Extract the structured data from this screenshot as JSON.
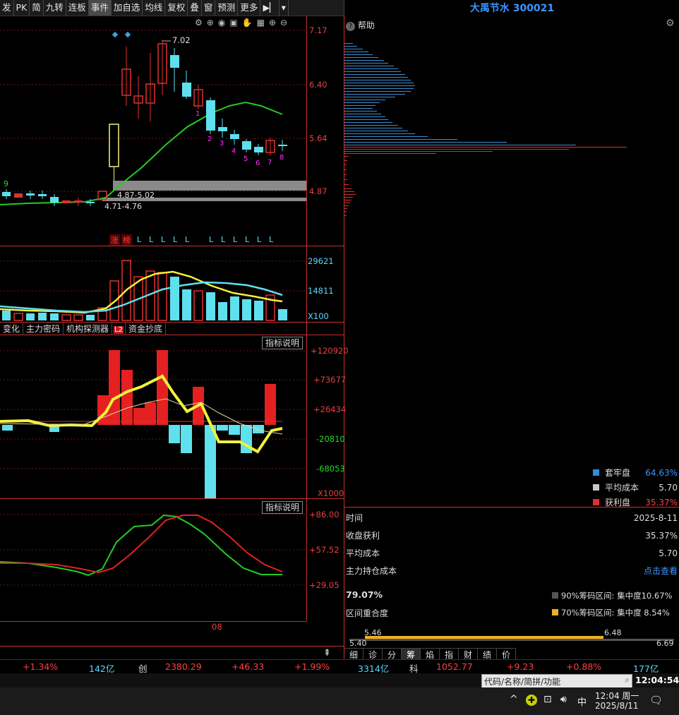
{
  "toolbar": {
    "items": [
      "发",
      "PK",
      "简",
      "九转",
      "连板",
      "事件",
      "加自选",
      "均线",
      "复权",
      "叠",
      "窗",
      "预测",
      "更多"
    ],
    "menu_icon": "dropdown-arrow-icon"
  },
  "stock_title": "大禹节水 300021",
  "help_label": "帮助",
  "kline": {
    "price_axis": [
      "7.17",
      "6.40",
      "5.64",
      "4.87"
    ],
    "high_label": "7.02",
    "low_marker": "9",
    "zone_labels": [
      "4.87-5.02",
      "4.71-4.76"
    ],
    "candle_nums": [
      "1",
      "2",
      "3",
      "4",
      "5",
      "6",
      "7",
      "8"
    ],
    "event_labels": [
      "涨",
      "榜"
    ],
    "l_marks": [
      "L",
      "L",
      "L",
      "L",
      "L",
      "L",
      "L",
      "L",
      "L",
      "L",
      "L"
    ]
  },
  "volume": {
    "axis": [
      "29621",
      "14811",
      "X100"
    ]
  },
  "indicator_tabs": [
    "变化",
    "主力密码",
    "机构探测器",
    "L2",
    "资金抄底"
  ],
  "indicator1": {
    "help": "指标说明",
    "axis": [
      "+120920",
      "+73677",
      "+26434",
      "-20810",
      "-68053",
      "X1000"
    ]
  },
  "indicator2": {
    "help": "指标说明",
    "axis": [
      "+86.00",
      "+57.52",
      "+29.05"
    ],
    "date_label": "08"
  },
  "chip": {
    "legend": [
      {
        "label": "套牢盘",
        "value": "64.63%",
        "color": "#2f8fd6"
      },
      {
        "label": "平均成本",
        "value": "5.70",
        "color": "#c8c8c8"
      },
      {
        "label": "获利盘",
        "value": "35.37%",
        "color": "#e03030"
      }
    ],
    "rows": [
      {
        "label": "时间",
        "value": "2025-8-11"
      },
      {
        "label": "收盘获利",
        "value": "35.37%"
      },
      {
        "label": "平均成本",
        "value": "5.70"
      },
      {
        "label": "主力持仓成本",
        "value": "点击查看"
      }
    ],
    "overlap_pct": "79.07%",
    "overlap_label": "区间重合度",
    "range90": "90%筹码区间: 集中度10.67%",
    "range70": "70%筹码区间: 集中度 8.54%",
    "bar_top_left": "5.46",
    "bar_top_right": "6.48",
    "bar_bot_left": "5.40",
    "bar_bot_right": "6.69"
  },
  "bottom_tabs": [
    "细",
    "诊",
    "分",
    "筹",
    "焰",
    "指",
    "财",
    "绩",
    "价"
  ],
  "status": {
    "items": [
      "+1.34%",
      "142亿",
      "创",
      "2380.29",
      "+46.33",
      "+1.99%",
      "3314亿",
      "科",
      "1052.77",
      "+9.23",
      "+0.88%",
      "177亿"
    ]
  },
  "search_placeholder": "代码/名称/简拼/功能",
  "clock": "12:04:54",
  "taskbar": {
    "time": "12:04 周一",
    "date": "2025/8/11",
    "ime": "中"
  }
}
